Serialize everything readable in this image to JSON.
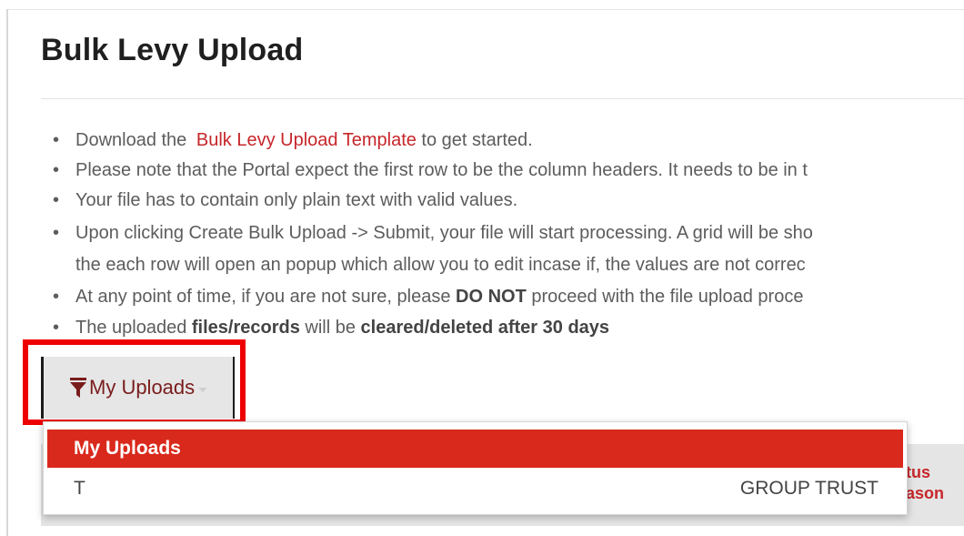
{
  "page": {
    "title": "Bulk Levy Upload"
  },
  "instructions": [
    {
      "pre": "Download the ",
      "link": "Bulk Levy Upload Template",
      "post": " to get started."
    },
    {
      "text": "Please note that the Portal expect the first row to be the column headers. It needs to be in t"
    },
    {
      "text": "Your file has to contain only plain text with valid values."
    },
    {
      "text": "Upon clicking Create Bulk Upload -> Submit, your file will start processing. A grid will be sho"
    },
    {
      "text": "the each row will open an popup which allow you to edit incase if, the values are not correc"
    },
    {
      "pre": "At any point of time, if you are not sure, please ",
      "bold": "DO NOT",
      "post": " proceed with the file upload proce"
    },
    {
      "pre": "The uploaded ",
      "bold1": "files/records",
      "mid": " will be ",
      "bold2": "cleared/deleted after 30 days"
    }
  ],
  "filter": {
    "label": "My Uploads",
    "icon": "funnel-icon",
    "accent": "#7a1c1c"
  },
  "dropdown": {
    "options": [
      {
        "label": "My Uploads",
        "selected": true
      },
      {
        "label": "T",
        "right_label": "GROUP TRUST",
        "selected": false
      }
    ],
    "highlight_color": "#d9291c"
  },
  "grid": {
    "status_header_line1": "atus",
    "status_header_line2": "eason"
  },
  "annotation": {
    "highlight_color": "#ee0000"
  }
}
